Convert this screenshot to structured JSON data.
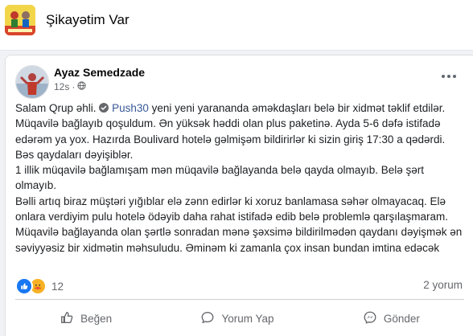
{
  "group": {
    "name": "Şikayətim Var"
  },
  "post": {
    "author": "Ayaz Semedzade",
    "time": "12s",
    "intro": "Salam Qrup əhli. ",
    "brand": "Push30",
    "body_first": " yeni yeni yarananda əməkdaşları belə bir xidmət təklif etdilər.",
    "body_rest": "Müqavilə bağlayıb qoşuldum. Ən yüksək həddi olan plus paketinə. Ayda 5-6 dəfə istifadə edərəm ya yox. Hazırda Boulivard hotelə gəlmişəm bildirirlər ki sizin giriş 17:30 a qədərdi. Bəs qaydaları dəyişiblər.\n1 illik müqavilə bağlamışam mən müqavilə bağlayanda belə qayda olmayıb. Belə şərt olmayıb.\nBəlli artıq biraz müştəri yığıblar elə zənn edirlər ki xoruz banlamasa səhər olmayacaq. Elə onlara verdiyim pulu hotelə ödəyib daha rahat istifadə edib belə problemlə qarşılaşmaram.\nMüqavilə bağlayanda olan şərtlə sonradan mənə şəxsimə bildirilmədən qaydanı dəyişmək ən səviyyəsiz bir xidmətin məhsuludu. Əminəm ki zamanla çox insan bundan imtina edəcək",
    "reaction_count": "12",
    "comment_count": "2 yorum"
  },
  "actions": {
    "like": "Beğen",
    "comment": "Yorum Yap",
    "send": "Gönder"
  },
  "icons": [
    "group-logo-icon",
    "globe-icon",
    "more-icon",
    "like-reaction-icon",
    "care-reaction-icon",
    "thumbs-up-icon",
    "comment-bubble-icon",
    "messenger-icon"
  ],
  "colors": {
    "like_blue": "#1877f2",
    "care_yellow": "#f7b125",
    "link": "#385898",
    "muted": "#65676b"
  }
}
